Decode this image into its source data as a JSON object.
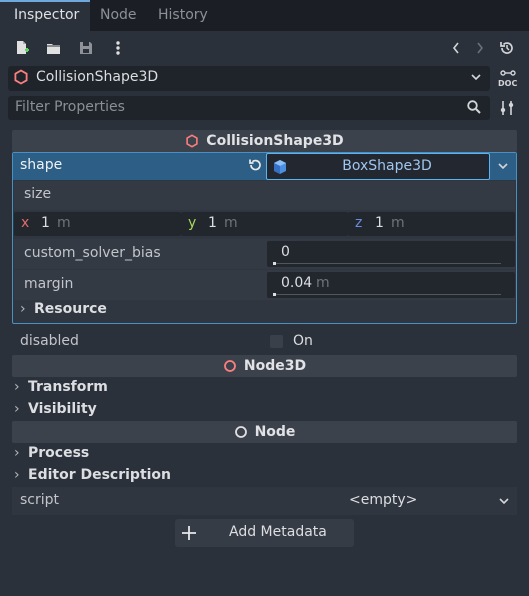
{
  "tabs": [
    {
      "label": "Inspector",
      "active": true
    },
    {
      "label": "Node",
      "active": false
    },
    {
      "label": "History",
      "active": false
    }
  ],
  "toolbar": {
    "icons": [
      "new-resource-icon",
      "load-resource-icon",
      "save-resource-icon",
      "more-options-icon",
      "history-back-icon",
      "history-forward-icon",
      "recent-history-icon"
    ]
  },
  "object_selector": {
    "value": "CollisionShape3D",
    "doc_label": "DOC"
  },
  "filter": {
    "placeholder": "Filter Properties"
  },
  "sections": {
    "collision": "CollisionShape3D",
    "node3d": "Node3D",
    "node": "Node"
  },
  "shape": {
    "label": "shape",
    "resource": "BoxShape3D",
    "size_label": "size",
    "size": [
      {
        "axis": "x",
        "value": "1",
        "unit": "m",
        "color": "#e06a6a"
      },
      {
        "axis": "y",
        "value": "1",
        "unit": "m",
        "color": "#a6d85a"
      },
      {
        "axis": "z",
        "value": "1",
        "unit": "m",
        "color": "#6a8ce0"
      }
    ],
    "custom_solver_bias": {
      "label": "custom_solver_bias",
      "value": "0"
    },
    "margin": {
      "label": "margin",
      "value": "0.04",
      "unit": "m"
    },
    "resource_group": "Resource"
  },
  "disabled": {
    "label": "disabled",
    "checkbox_label": "On",
    "checked": false
  },
  "groups": {
    "transform": "Transform",
    "visibility": "Visibility",
    "process": "Process",
    "editor_description": "Editor Description"
  },
  "script": {
    "label": "script",
    "value": "<empty>"
  },
  "add_metadata": {
    "label": "Add Metadata"
  },
  "colors": {
    "accent": "#5ab4ef",
    "node3d": "#fc7f7f",
    "selection": "#2d5f86"
  }
}
